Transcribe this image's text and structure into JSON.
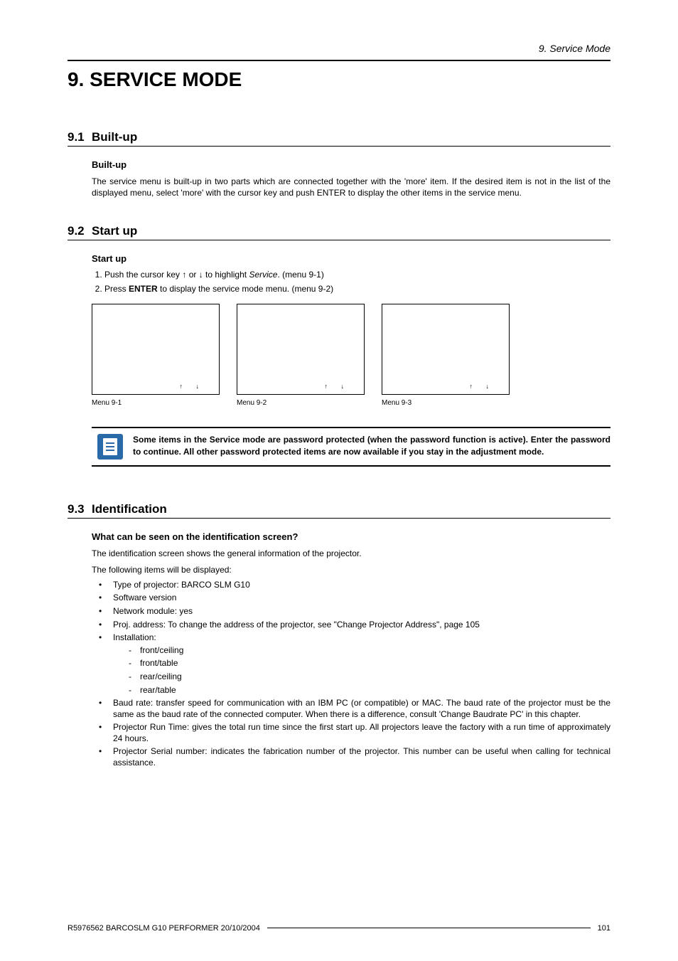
{
  "header_label": "9. Service Mode",
  "title": "9. SERVICE MODE",
  "s91": {
    "num": "9.1",
    "heading": "Built-up",
    "subhead": "Built-up",
    "para": "The service menu is built-up in two parts which are connected together with the 'more' item. If the desired item is not in the list of the displayed menu, select 'more' with the cursor key and push ENTER to display the other items in the service menu."
  },
  "s92": {
    "num": "9.2",
    "heading": "Start up",
    "subhead": "Start up",
    "step1_a": "Push the cursor key ↑ or ↓ to highlight ",
    "step1_i": "Service",
    "step1_b": ". (menu 9-1)",
    "step2_a": "Press ",
    "step2_b": "ENTER",
    "step2_c": " to display the service mode menu. (menu 9-2)",
    "menu1_cap": "Menu 9-1",
    "menu2_cap": "Menu 9-2",
    "menu3_cap": "Menu 9-3",
    "arrows": "↑  ↓"
  },
  "note_text": "Some items in the Service mode are password protected (when the password function is active). Enter the password to continue. All other password protected items are now available if you stay in the adjustment mode.",
  "s93": {
    "num": "9.3",
    "heading": "Identification",
    "subhead": "What can be seen on the identification screen?",
    "para1": "The identification screen shows the general information of the projector.",
    "para2": "The following items will be displayed:",
    "b1": "Type of projector: BARCO SLM G10",
    "b2": "Software version",
    "b3": "Network module: yes",
    "b4": "Proj. address: To change the address of the projector, see \"Change Projector Address\", page 105",
    "b5": "Installation:",
    "b5a": "front/ceiling",
    "b5b": "front/table",
    "b5c": "rear/ceiling",
    "b5d": "rear/table",
    "b6": "Baud rate: transfer speed for communication with an IBM PC (or compatible) or MAC. The baud rate of the projector must be the same as the baud rate of the connected computer. When there is a difference, consult 'Change Baudrate PC' in this chapter.",
    "b7": "Projector Run Time: gives the total run time since the first start up. All projectors leave the factory with a run time of approximately 24 hours.",
    "b8": "Projector Serial number: indicates the fabrication number of the projector. This number can be useful when calling for technical assistance."
  },
  "footer_left": "R5976562  BARCOSLM G10 PERFORMER  20/10/2004",
  "footer_right": "101"
}
